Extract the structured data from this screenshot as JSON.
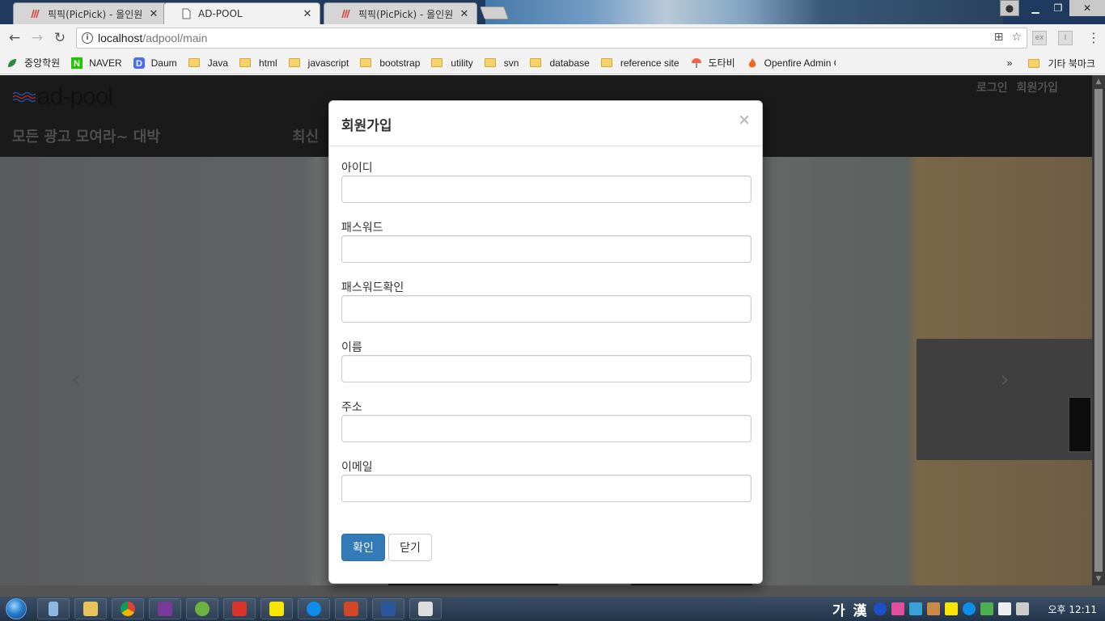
{
  "browser": {
    "tabs": [
      {
        "title": "픽픽(PicPick) - 올인원 그",
        "active": false
      },
      {
        "title": "AD-POOL",
        "active": true
      },
      {
        "title": "픽픽(PicPick) - 올인원 그",
        "active": false
      }
    ],
    "url_host": "localhost",
    "url_path": "/adpool/main",
    "bookmarks": [
      {
        "label": "중앙학원",
        "type": "site"
      },
      {
        "label": "NAVER",
        "type": "site"
      },
      {
        "label": "Daum",
        "type": "site"
      },
      {
        "label": "Java",
        "type": "folder"
      },
      {
        "label": "html",
        "type": "folder"
      },
      {
        "label": "javascript",
        "type": "folder"
      },
      {
        "label": "bootstrap",
        "type": "folder"
      },
      {
        "label": "utility",
        "type": "folder"
      },
      {
        "label": "svn",
        "type": "folder"
      },
      {
        "label": "database",
        "type": "folder"
      },
      {
        "label": "reference site",
        "type": "folder"
      },
      {
        "label": "도타비",
        "type": "site"
      },
      {
        "label": "Openfire Admin Co",
        "type": "site"
      }
    ],
    "bookmarks_more": "»",
    "other_bookmarks": "기타 북마크"
  },
  "site": {
    "logo": "ad-pool",
    "tagline": "모든 광고 모여라~ 대박",
    "nav_link": "최신",
    "login": "로그인",
    "signup": "회원가입"
  },
  "modal": {
    "title": "회원가입",
    "close": "×",
    "fields": [
      {
        "label": "아이디",
        "value": ""
      },
      {
        "label": "패스워드",
        "value": ""
      },
      {
        "label": "패스워드확인",
        "value": ""
      },
      {
        "label": "이름",
        "value": ""
      },
      {
        "label": "주소",
        "value": ""
      },
      {
        "label": "이메일",
        "value": ""
      }
    ],
    "confirm": "확인",
    "cancel": "닫기"
  },
  "taskbar": {
    "ime": "가 漢",
    "clock": "오후 12:11"
  }
}
